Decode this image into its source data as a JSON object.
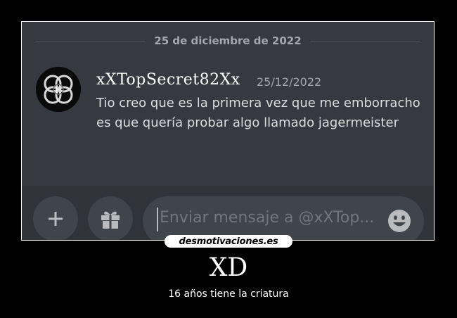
{
  "chat": {
    "date_divider": "25 de diciembre de 2022",
    "message": {
      "username": "xXTopSecret82Xx",
      "timestamp": "25/12/2022",
      "text": "Tio creo que es la primera vez que me emborracho es que quería probar algo llamado jagermeister"
    },
    "input": {
      "placeholder": "Enviar mensaje a @xXTop..."
    },
    "icons": {
      "add": "plus-icon",
      "gift": "gift-icon",
      "emoji": "emoji-icon"
    },
    "colors": {
      "background": "#36393f",
      "input_background": "#40444b",
      "text": "#dcddde",
      "muted": "#a3a6aa",
      "emoji": "#b9bbbe"
    }
  },
  "poster": {
    "watermark": "desmotivaciones.es",
    "title": "XD",
    "subtitle": "16 años tiene la criatura"
  }
}
